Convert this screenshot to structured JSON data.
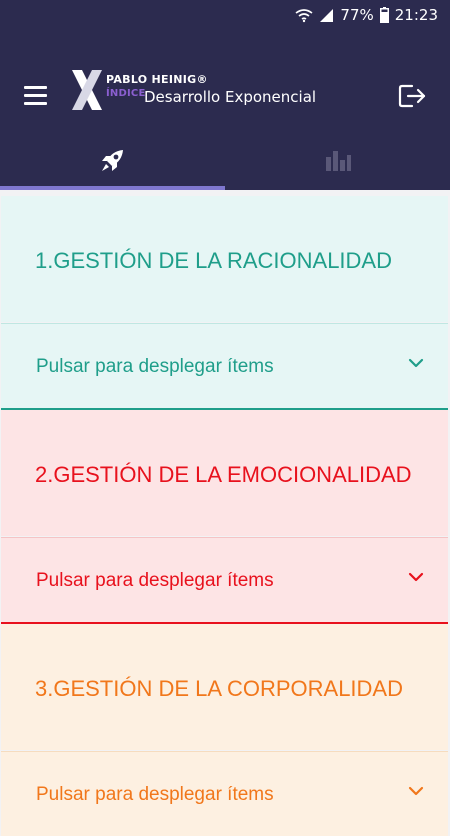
{
  "status": {
    "battery": "77%",
    "time": "21:23",
    "icons": [
      "wifi-icon",
      "signal-icon",
      "battery-icon"
    ]
  },
  "header": {
    "logo_brand": "PABLO HEINIG®",
    "logo_index": "ÍNDICE",
    "logo_title": "Desarrollo Exponencial",
    "icons": [
      "menu-icon",
      "logo-x-icon",
      "logout-icon"
    ]
  },
  "tabs": [
    {
      "icon": "rocket-icon",
      "selected": true
    },
    {
      "icon": "bar-chart-icon",
      "selected": false
    }
  ],
  "sections": [
    {
      "title": "1.GESTIÓN DE LA RACIONALIDAD",
      "expander_label": "Pulsar para desplegar ítems",
      "color": "#1f9e8a",
      "bg": "#e6f6f5"
    },
    {
      "title": "2.GESTIÓN DE LA EMOCIONALIDAD",
      "expander_label": "Pulsar para desplegar ítems",
      "color": "#e8111d",
      "bg": "#fde4e5"
    },
    {
      "title": "3.GESTIÓN DE LA CORPORALIDAD",
      "expander_label": "Pulsar para desplegar ítems",
      "color": "#f1771b",
      "bg": "#fdf0e1"
    }
  ]
}
